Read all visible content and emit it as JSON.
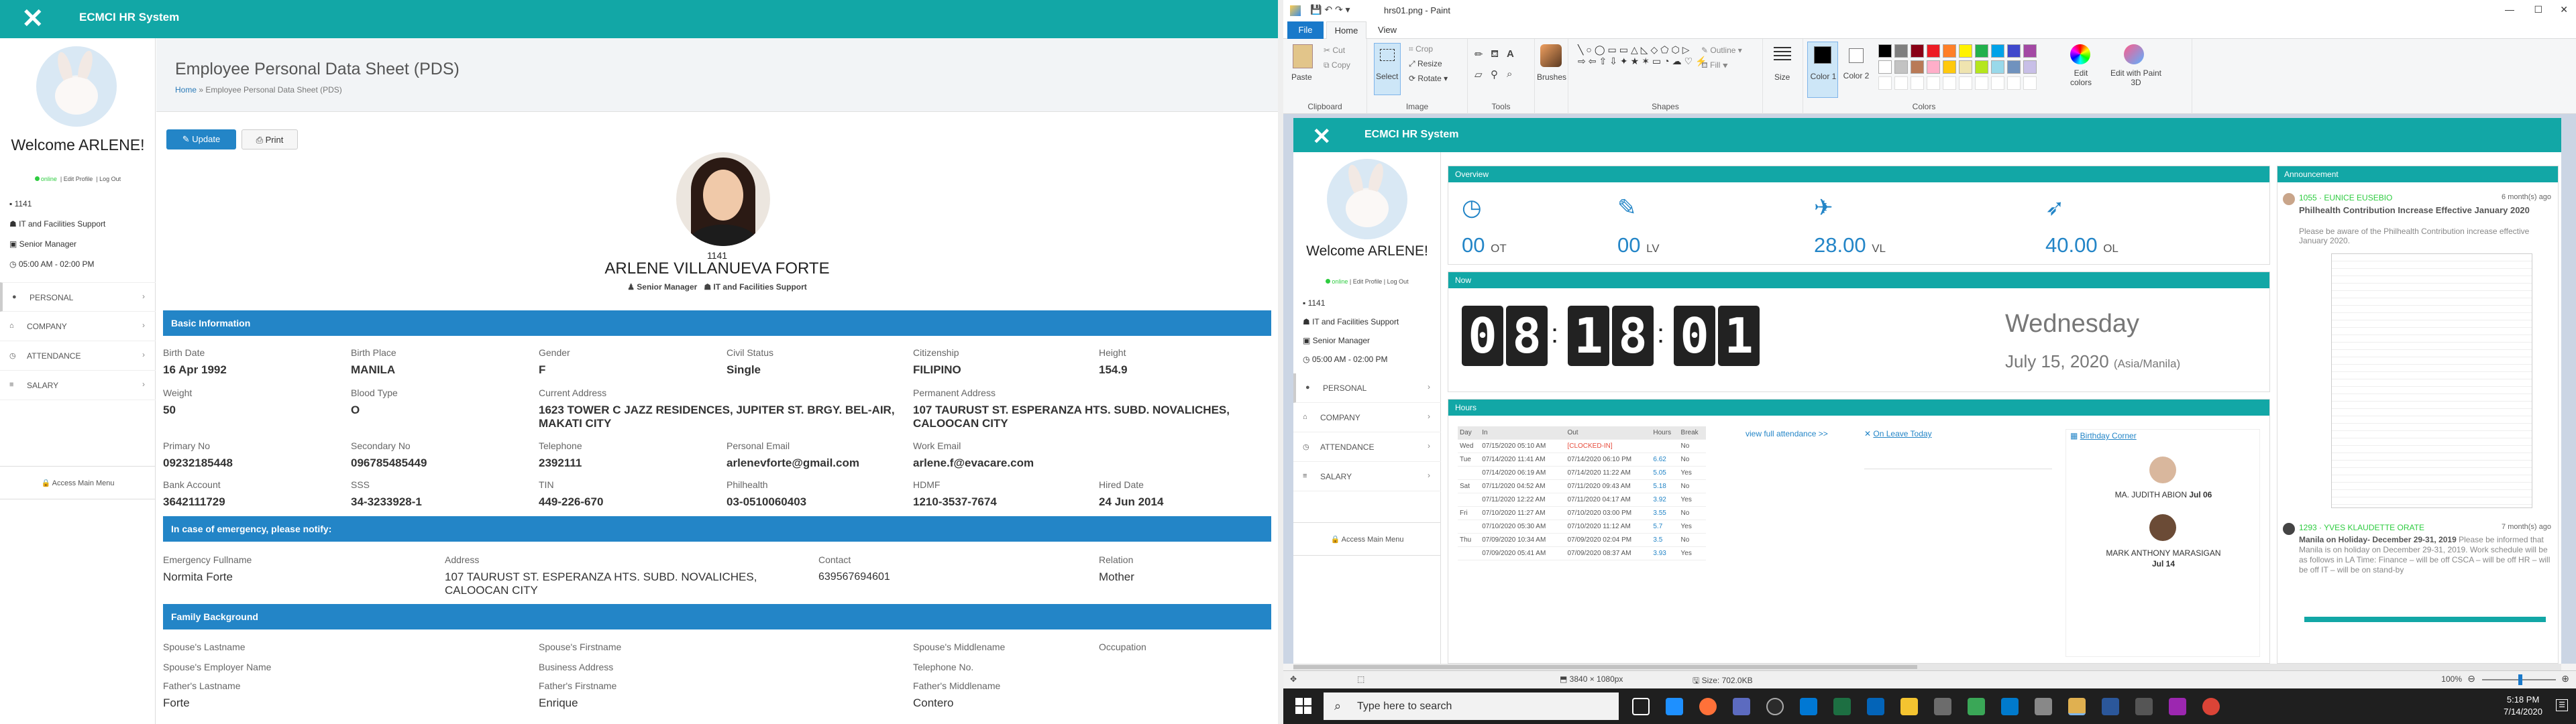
{
  "app": {
    "title": "ECMCI HR System",
    "close_icon": "close-icon"
  },
  "sidebar": {
    "welcome": "Welcome ARLENE!",
    "status_online": "online",
    "status_edit": "Edit Profile",
    "status_logout": "Log Out",
    "employee_id": "1141",
    "department": "IT and Facilities Support",
    "position": "Senior Manager",
    "schedule": "05:00 AM - 02:00 PM",
    "nav": [
      {
        "label": "PERSONAL",
        "icon": "user-icon"
      },
      {
        "label": "COMPANY",
        "icon": "home-icon"
      },
      {
        "label": "ATTENDANCE",
        "icon": "clock-icon"
      },
      {
        "label": "SALARY",
        "icon": "bars-icon"
      }
    ],
    "access_main_menu": "Access Main Menu"
  },
  "pds": {
    "page_title": "Employee Personal Data Sheet (PDS)",
    "breadcrumb_home": "Home",
    "breadcrumb_current": "Employee Personal Data Sheet (PDS)",
    "update_label": "Update",
    "print_label": "Print",
    "emp_id": "1141",
    "emp_name": "ARLENE VILLANUEVA FORTE",
    "emp_position": "Senior Manager",
    "emp_department": "IT and Facilities Support",
    "basic_info_heading": "Basic Information",
    "fields": [
      {
        "label": "Birth Date",
        "value": "16 Apr 1992"
      },
      {
        "label": "Birth Place",
        "value": "MANILA"
      },
      {
        "label": "Gender",
        "value": "F"
      },
      {
        "label": "Civil Status",
        "value": "Single"
      },
      {
        "label": "Citizenship",
        "value": "FILIPINO"
      },
      {
        "label": "Height",
        "value": "154.9"
      },
      {
        "label": "Weight",
        "value": "50"
      },
      {
        "label": "Blood Type",
        "value": "O"
      },
      {
        "label": "Current Address",
        "value": "1623 TOWER C JAZZ RESIDENCES, JUPITER ST. BRGY. BEL-AIR, MAKATI CITY"
      },
      {
        "label": "Permanent Address",
        "value": "107 TAURUST ST. ESPERANZA HTS. SUBD. NOVALICHES, CALOOCAN CITY"
      },
      {
        "label": "Primary No",
        "value": "09232185448"
      },
      {
        "label": "Secondary No",
        "value": "096785485449"
      },
      {
        "label": "Telephone",
        "value": "2392111"
      },
      {
        "label": "Personal Email",
        "value": "arlenevforte@gmail.com"
      },
      {
        "label": "Work Email",
        "value": "arlene.f@evacare.com"
      },
      {
        "label": "Bank Account",
        "value": "3642111729"
      },
      {
        "label": "SSS",
        "value": "34-3233928-1"
      },
      {
        "label": "TIN",
        "value": "449-226-670"
      },
      {
        "label": "Philhealth",
        "value": "03-0510060403"
      },
      {
        "label": "HDMF",
        "value": "1210-3537-7674"
      },
      {
        "label": "Hired Date",
        "value": "24 Jun 2014"
      }
    ],
    "emergency_heading": "In case of emergency, please notify:",
    "emergency": [
      {
        "label": "Emergency Fullname",
        "value": "Normita Forte"
      },
      {
        "label": "Address",
        "value": "107 TAURUST ST. ESPERANZA HTS. SUBD. NOVALICHES, CALOOCAN CITY"
      },
      {
        "label": "Contact",
        "value": "639567694601"
      },
      {
        "label": "Relation",
        "value": "Mother"
      }
    ],
    "family_heading": "Family Background",
    "family_labels": [
      "Spouse's Lastname",
      "Spouse's Firstname",
      "Spouse's Middlename",
      "Occupation",
      "Spouse's Employer Name",
      "Business Address",
      "Telephone No.",
      "Father's Lastname",
      "Father's Firstname",
      "Father's Middlename"
    ],
    "father_values": [
      "Forte",
      "Enrique",
      "Contero"
    ]
  },
  "paint": {
    "window_title": "hrs01.png - Paint",
    "tabs": [
      "File",
      "Home",
      "View"
    ],
    "groups": [
      "Clipboard",
      "Image",
      "Tools",
      "Shapes",
      "Colors"
    ],
    "paste": "Paste",
    "cut": "Cut",
    "copy": "Copy",
    "select": "Select",
    "crop": "Crop",
    "resize": "Resize",
    "rotate": "Rotate",
    "brushes": "Brushes",
    "outline": "Outline",
    "fill": "Fill",
    "size": "Size",
    "color1": "Color 1",
    "color2": "Color 2",
    "edit_colors": "Edit colors",
    "edit_paint3d": "Edit with Paint 3D",
    "palette": [
      "#000000",
      "#7f7f7f",
      "#880015",
      "#ed1c24",
      "#ff7f27",
      "#fff200",
      "#22b14c",
      "#00a2e8",
      "#3f48cc",
      "#a349a4",
      "#ffffff",
      "#c3c3c3",
      "#b97a57",
      "#ffaec9",
      "#ffc90e",
      "#efe4b0",
      "#b5e61d",
      "#99d9ea",
      "#7092be",
      "#c8bfe7"
    ],
    "status_dims": "3840 × 1080px",
    "status_size": "Size: 702.0KB",
    "zoom": "100%"
  },
  "dashboard": {
    "overview": "Overview",
    "stats": [
      {
        "value": "00",
        "unit": "OT",
        "icon": "clock-icon"
      },
      {
        "value": "00",
        "unit": "LV",
        "icon": "edit-icon"
      },
      {
        "value": "28.00",
        "unit": "VL",
        "icon": "plane-icon"
      },
      {
        "value": "40.00",
        "unit": "OL",
        "icon": "rocket-icon"
      }
    ],
    "now": "Now",
    "clock": [
      "0",
      "8",
      "1",
      "8",
      "0",
      "1"
    ],
    "day": "Wednesday",
    "date": "July 15, 2020",
    "tz": "(Asia/Manila)",
    "hours": "Hours",
    "hours_cols": [
      "Day",
      "In",
      "Out",
      "Hours",
      "Break"
    ],
    "hours_rows": [
      [
        "Wed",
        "07/15/2020 05:10 AM",
        "[CLOCKED-IN]",
        "",
        "No"
      ],
      [
        "Tue",
        "07/14/2020 11:41 AM",
        "07/14/2020 06:10 PM",
        "6.62",
        "No"
      ],
      [
        "",
        "07/14/2020 06:19 AM",
        "07/14/2020 11:22 AM",
        "5.05",
        "Yes"
      ],
      [
        "Sat",
        "07/11/2020 04:52 AM",
        "07/11/2020 09:43 AM",
        "5.18",
        "No"
      ],
      [
        "",
        "07/11/2020 12:22 AM",
        "07/11/2020 04:17 AM",
        "3.92",
        "Yes"
      ],
      [
        "Fri",
        "07/10/2020 11:27 AM",
        "07/10/2020 03:00 PM",
        "3.55",
        "No"
      ],
      [
        "",
        "07/10/2020 05:30 AM",
        "07/10/2020 11:12 AM",
        "5.7",
        "Yes"
      ],
      [
        "Thu",
        "07/09/2020 10:34 AM",
        "07/09/2020 02:04 PM",
        "3.5",
        "No"
      ],
      [
        "",
        "07/09/2020 05:41 AM",
        "07/09/2020 08:37 AM",
        "3.93",
        "Yes"
      ]
    ],
    "view_full": "view full attendance >>",
    "on_leave": "On Leave Today",
    "birthday_corner": "Birthday Corner",
    "birthdays": [
      {
        "name": "MA. JUDITH ABION",
        "date": "Jul 06"
      },
      {
        "name": "MARK ANTHONY MARASIGAN",
        "date": "Jul 14"
      }
    ],
    "announcement": "Announcement",
    "ann1_meta": "1055 · EUNICE EUSEBIO",
    "ann1_age": "6 month(s) ago",
    "ann1_title": "Philhealth Contribution Increase Effective January 2020",
    "ann1_body": "Please be aware of the Philhealth Contribution increase effective January 2020.",
    "ann2_meta": "1293 · YVES KLAUDETTE ORATE",
    "ann2_age": "7 month(s) ago",
    "ann2_title": "Manila on Holiday- December 29-31, 2019",
    "ann2_body": "Please be informed that Manila is on holiday on December 29-31, 2019. Work schedule will be as follows in LA Time: Finance – will be off CSCA – will be off HR – will be off IT – will be on stand-by"
  },
  "taskbar": {
    "search_placeholder": "Type here to search",
    "time": "5:18 PM",
    "date": "7/14/2020"
  }
}
